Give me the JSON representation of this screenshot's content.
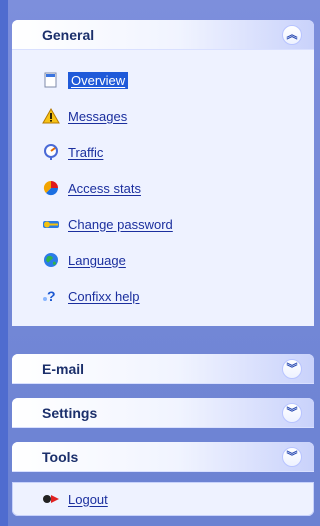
{
  "sections": {
    "general": {
      "title": "General",
      "items": [
        {
          "label": "Overview",
          "icon": "document-icon"
        },
        {
          "label": "Messages",
          "icon": "warning-icon"
        },
        {
          "label": "Traffic",
          "icon": "speedometer-icon"
        },
        {
          "label": "Access stats",
          "icon": "pie-chart-icon"
        },
        {
          "label": "Change password",
          "icon": "key-icon"
        },
        {
          "label": "Language",
          "icon": "globe-icon"
        },
        {
          "label": "Confixx help",
          "icon": "help-icon"
        }
      ]
    },
    "email": {
      "title": "E-mail"
    },
    "settings": {
      "title": "Settings"
    },
    "tools": {
      "title": "Tools"
    },
    "logout": {
      "label": "Logout",
      "icon": "logout-icon"
    }
  }
}
